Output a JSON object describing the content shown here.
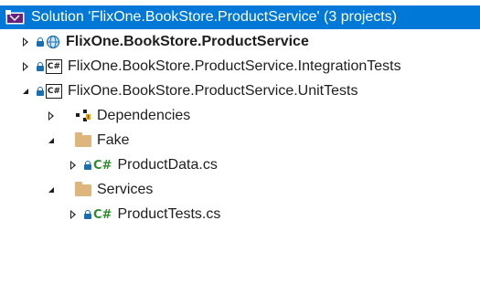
{
  "solution": {
    "label": "Solution 'FlixOne.BookStore.ProductService' (3 projects)"
  },
  "projects": [
    {
      "label": "FlixOne.BookStore.ProductService"
    },
    {
      "label": "FlixOne.BookStore.ProductService.IntegrationTests"
    },
    {
      "label": "FlixOne.BookStore.ProductService.UnitTests"
    }
  ],
  "unit_tests_children": {
    "dependencies": "Dependencies",
    "fake_folder": "Fake",
    "fake_file": "ProductData.cs",
    "services_folder": "Services",
    "services_file": "ProductTests.cs"
  },
  "icons": {
    "cs_glyph": "C#",
    "csproj_glyph": "C#"
  },
  "colors": {
    "selection": "#0078d7",
    "folder": "#dcb67a",
    "csharp": "#2e8b2e"
  }
}
